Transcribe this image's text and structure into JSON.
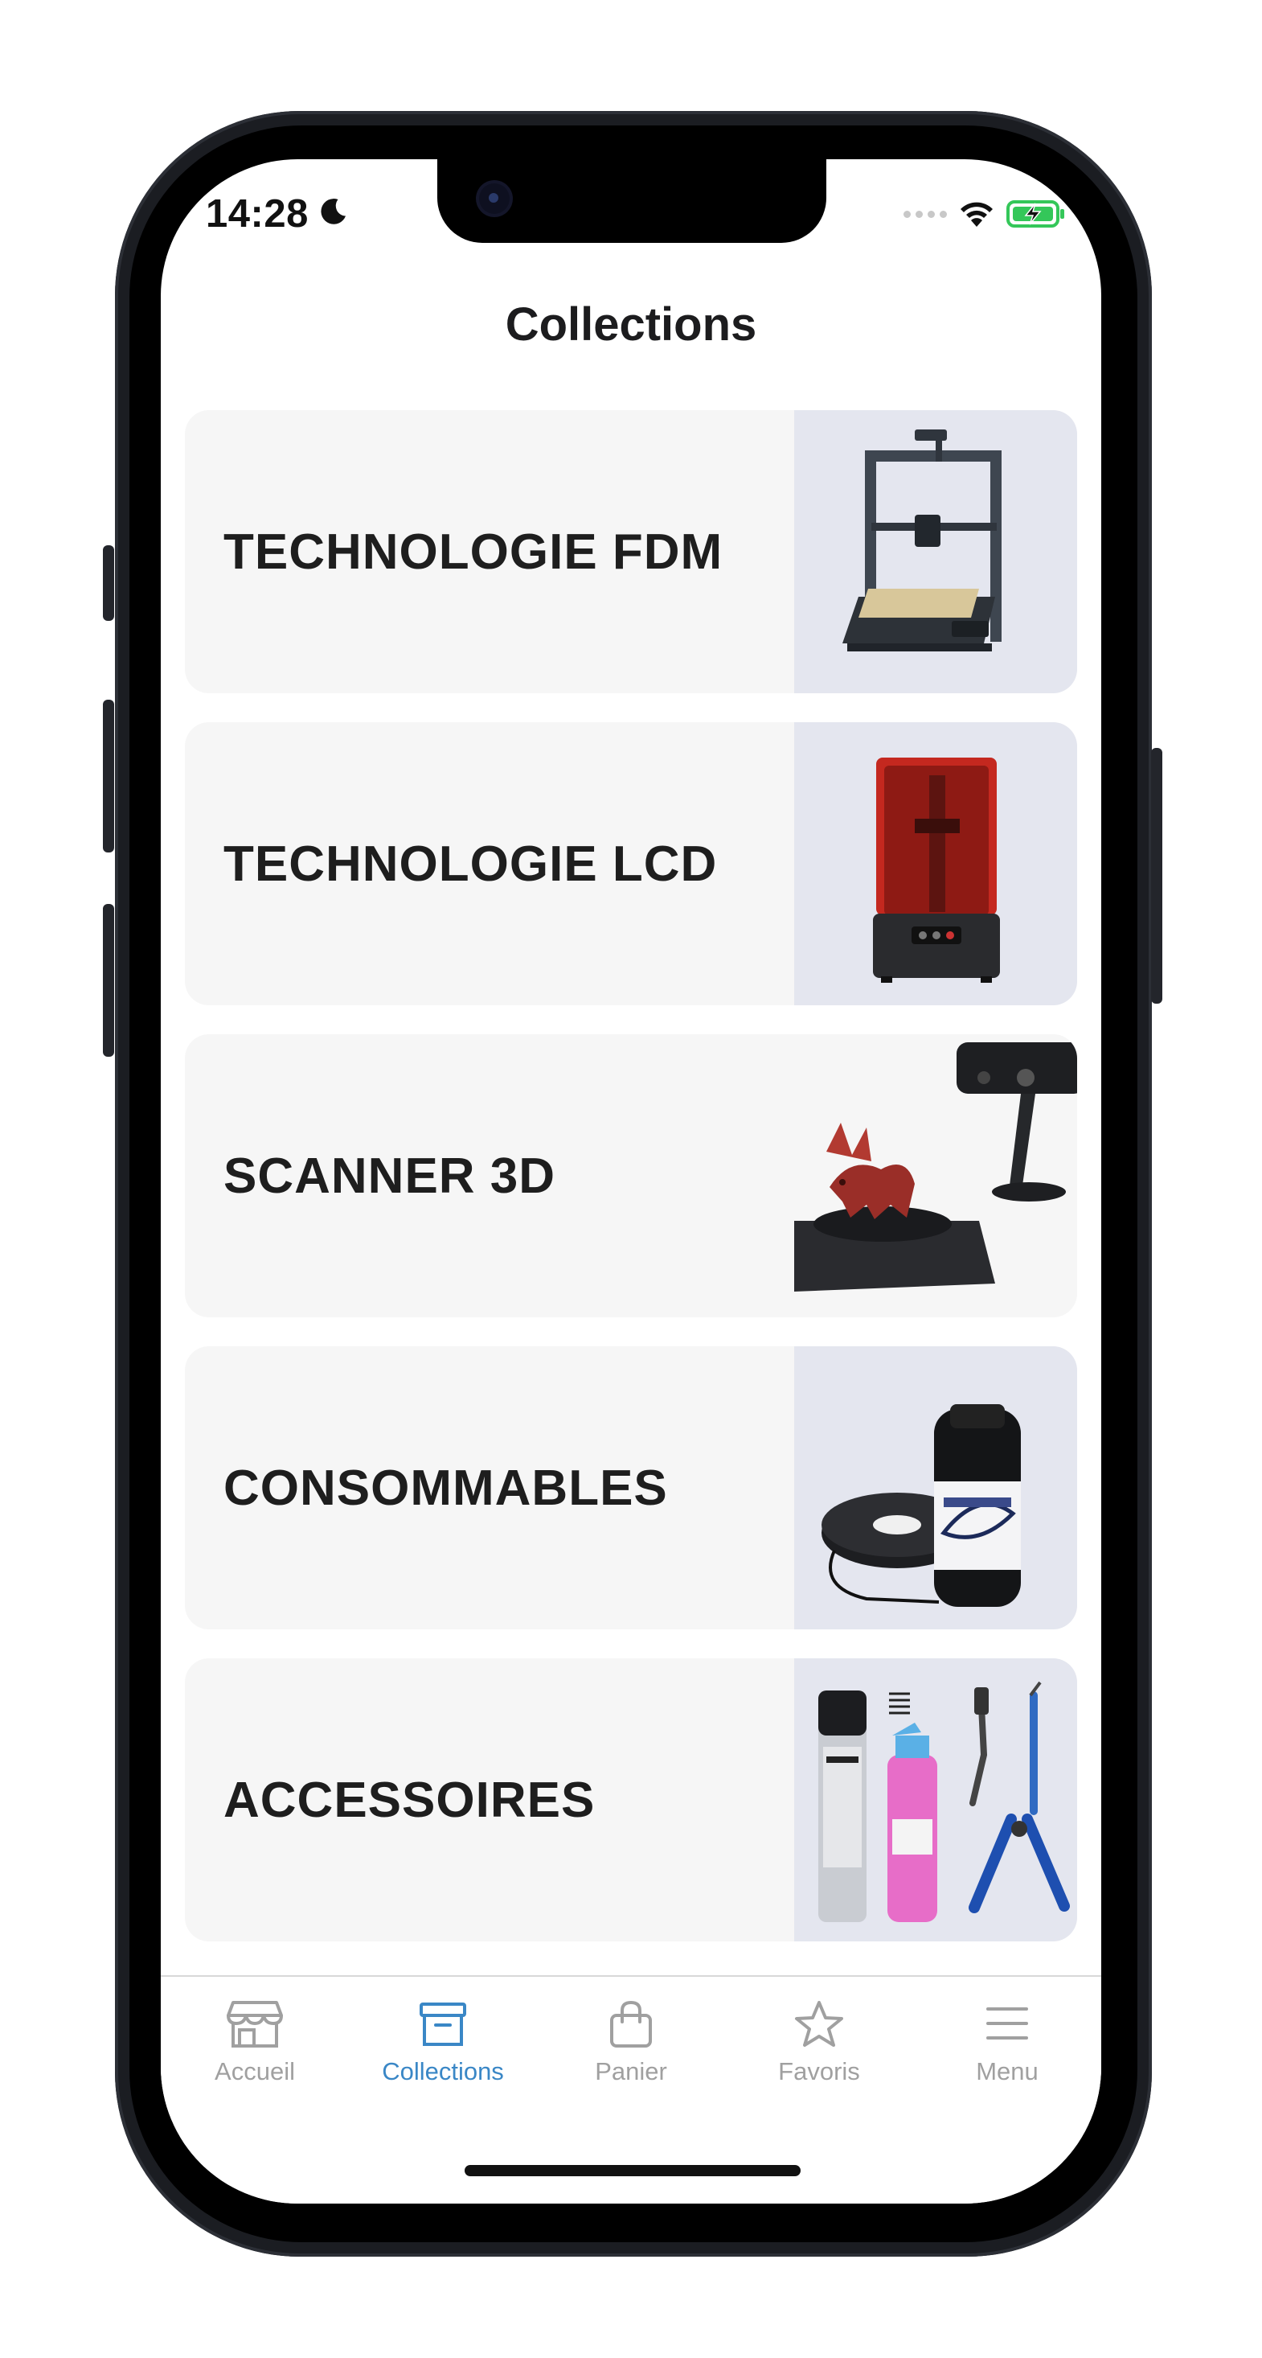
{
  "status_bar": {
    "time": "14:28"
  },
  "header": {
    "title": "Collections"
  },
  "collections": [
    {
      "label": "TECHNOLOGIE FDM",
      "image": "fdm-printer-image"
    },
    {
      "label": "TECHNOLOGIE LCD",
      "image": "lcd-resin-printer-image"
    },
    {
      "label": "SCANNER 3D",
      "image": "3d-scanner-image"
    },
    {
      "label": "CONSOMMABLES",
      "image": "filament-and-resin-image"
    },
    {
      "label": "ACCESSOIRES",
      "image": "tools-and-sprays-image"
    }
  ],
  "tabbar": {
    "active": "Collections",
    "active_color": "#3a87c6",
    "inactive_color": "#a0a0a0",
    "items": [
      {
        "label": "Accueil",
        "icon": "store-icon"
      },
      {
        "label": "Collections",
        "icon": "archive-box-icon"
      },
      {
        "label": "Panier",
        "icon": "shopping-bag-icon"
      },
      {
        "label": "Favoris",
        "icon": "star-icon"
      },
      {
        "label": "Menu",
        "icon": "hamburger-menu-icon"
      }
    ]
  }
}
